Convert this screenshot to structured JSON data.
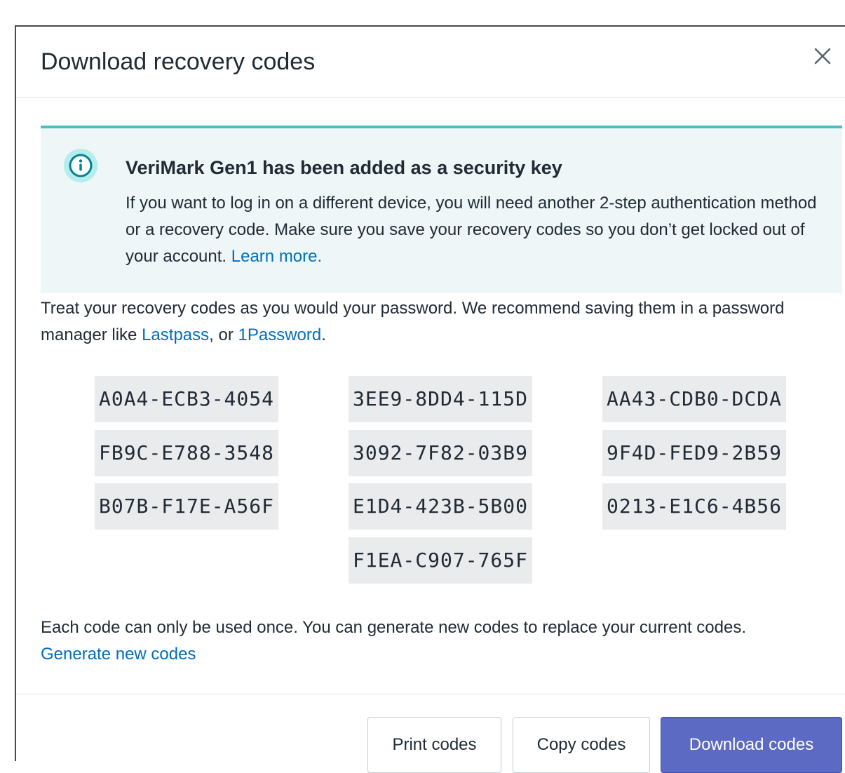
{
  "modal": {
    "title": "Download recovery codes",
    "close_label": "Close"
  },
  "banner": {
    "icon": "info-circle-icon",
    "accent_color": "#47c1bf",
    "title": "VeriMark Gen1 has been added as a security key",
    "body": "If you want to log in on a different device, you will need another 2-step authentication method or a recovery code. Make sure you save your recovery codes so you don’t get locked out of your account.",
    "learn_more": "Learn more."
  },
  "intro": {
    "text_before": "Treat your recovery codes as you would your password. We recommend saving them in a password manager like ",
    "lastpass": "Lastpass",
    "separator": ", or ",
    "onepassword": "1Password",
    "text_after": "."
  },
  "codes": [
    "A0A4-ECB3-4054",
    "3EE9-8DD4-115D",
    "AA43-CDB0-DCDA",
    "FB9C-E788-3548",
    "3092-7F82-03B9",
    "9F4D-FED9-2B59",
    "B07B-F17E-A56F",
    "E1D4-423B-5B00",
    "0213-E1C6-4B56",
    "F1EA-C907-765F"
  ],
  "footer": {
    "text": "Each code can only be used once. You can generate new codes to replace your current codes.",
    "generate_link": "Generate new codes"
  },
  "actions": {
    "print": "Print codes",
    "copy": "Copy codes",
    "download": "Download codes",
    "primary_color": "#5c6ac4"
  }
}
